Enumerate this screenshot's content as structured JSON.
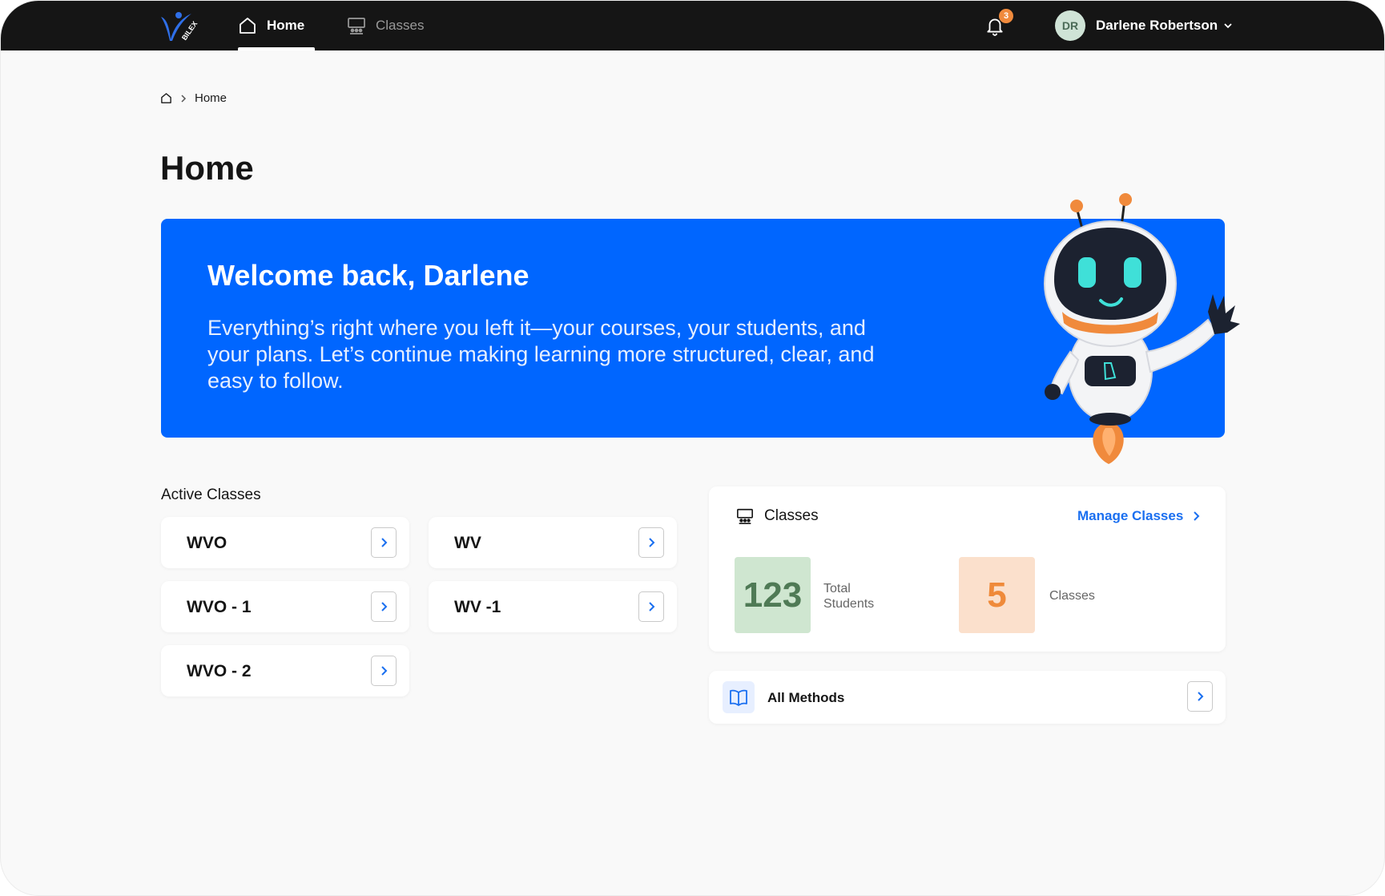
{
  "nav": {
    "logo_text": "BILEX",
    "tabs": [
      {
        "label": "Home",
        "active": true
      },
      {
        "label": "Classes",
        "active": false
      }
    ],
    "notifications_count": "3",
    "user": {
      "initials": "DR",
      "name": "Darlene Robertson"
    }
  },
  "breadcrumb": {
    "current": "Home"
  },
  "page_title": "Home",
  "banner": {
    "title": "Welcome back, Darlene",
    "text": "Everything’s right where you left it—your courses, your students, and your plans. Let’s continue making learning more structured, clear, and easy to follow."
  },
  "active_classes": {
    "label": "Active Classes",
    "items": [
      {
        "name": "WVO"
      },
      {
        "name": "WV"
      },
      {
        "name": "WVO - 1"
      },
      {
        "name": "WV -1"
      },
      {
        "name": "WVO - 2"
      }
    ]
  },
  "classes_card": {
    "title": "Classes",
    "manage_label": "Manage Classes",
    "total_students": {
      "value": "123",
      "label_line1": "Total",
      "label_line2": "Students"
    },
    "classes_count": {
      "value": "5",
      "label": "Classes"
    }
  },
  "methods": {
    "label": "All Methods"
  },
  "colors": {
    "accent": "#0066ff",
    "topbar": "#151515",
    "link": "#1a6ff0",
    "badge": "#f08a3c",
    "stat_green_bg": "#cfe6d0",
    "stat_orange_bg": "#fbe0cc"
  }
}
